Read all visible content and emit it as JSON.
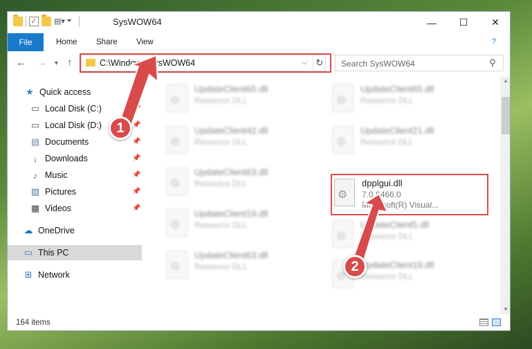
{
  "window": {
    "title": "SysWOW64",
    "controls": {
      "minimize": "—",
      "maximize": "☐",
      "close": "✕"
    }
  },
  "ribbon": {
    "tabs": [
      {
        "label": "File",
        "active": true
      },
      {
        "label": "Home"
      },
      {
        "label": "Share"
      },
      {
        "label": "View"
      }
    ],
    "help": "?"
  },
  "address": {
    "path": "C:\\Windows\\SysWOW64",
    "search_placeholder": "Search SysWOW64"
  },
  "sidebar": {
    "items": [
      {
        "label": "Quick access",
        "icon": "star-icon"
      },
      {
        "label": "Local Disk (C:)",
        "icon": "drive-icon",
        "pinned": true
      },
      {
        "label": "Local Disk (D:)",
        "icon": "drive-icon",
        "pinned": true
      },
      {
        "label": "Documents",
        "icon": "documents-icon",
        "pinned": true
      },
      {
        "label": "Downloads",
        "icon": "download-icon",
        "pinned": true
      },
      {
        "label": "Music",
        "icon": "music-icon",
        "pinned": true
      },
      {
        "label": "Pictures",
        "icon": "pictures-icon",
        "pinned": true
      },
      {
        "label": "Videos",
        "icon": "videos-icon",
        "pinned": true
      },
      {
        "label": "OneDrive",
        "icon": "cloud-icon"
      },
      {
        "label": "This PC",
        "icon": "computer-icon",
        "selected": true
      },
      {
        "label": "Network",
        "icon": "network-icon"
      }
    ]
  },
  "files": [
    {
      "name": "UpdateClient65.dll",
      "line1": "Resource DLL",
      "line2": "",
      "blurred": true
    },
    {
      "name": "UpdateClient65.dll",
      "line1": "Resource DLL",
      "line2": "",
      "blurred": true
    },
    {
      "name": "UpdateClient42.dll",
      "line1": "Resource DLL",
      "line2": "",
      "blurred": true
    },
    {
      "name": "UpdateClient21.dll",
      "line1": "Resource DLL",
      "line2": "",
      "blurred": true
    },
    {
      "name": "UpdateClient63.dll",
      "line1": "Resource DLL",
      "line2": "",
      "blurred": true
    },
    {
      "name": "dpplgui.dll",
      "line1": "7.0.9466.0",
      "line2": "Microsoft(R) Visual...",
      "blurred": false
    },
    {
      "name": "UpdateClient19.dll",
      "line1": "Resource DLL",
      "line2": "",
      "blurred": true
    },
    {
      "name": "UpdateClient5.dll",
      "line1": "Resource DLL",
      "line2": "",
      "blurred": true
    },
    {
      "name": "UpdateClient63.dll",
      "line1": "Resource DLL",
      "line2": "",
      "blurred": true
    },
    {
      "name": "UpdateClient19.dll",
      "line1": "Resource DLL",
      "line2": "",
      "blurred": true
    }
  ],
  "status": {
    "count": "164 items"
  },
  "callouts": [
    {
      "label": "1"
    },
    {
      "label": "2"
    }
  ],
  "colors": {
    "accent": "#1979ca",
    "highlight": "#d94a4a"
  }
}
